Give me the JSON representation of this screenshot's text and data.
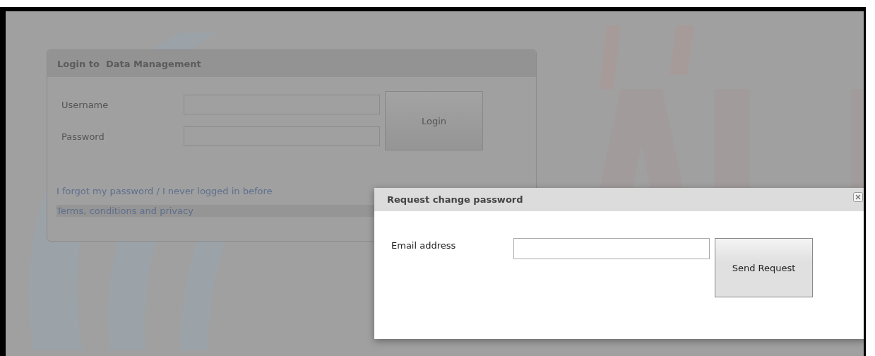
{
  "login_panel": {
    "title": "Login to  Data Management",
    "fields": [
      {
        "label": "Username"
      },
      {
        "label": "Password"
      }
    ],
    "button": "Login",
    "links": [
      "I forgot my password / I never logged in before",
      "Terms, conditions and privacy"
    ]
  },
  "dialog": {
    "title": "Request change password",
    "fields": [
      {
        "label": "Email address"
      }
    ],
    "button": "Send Request"
  }
}
